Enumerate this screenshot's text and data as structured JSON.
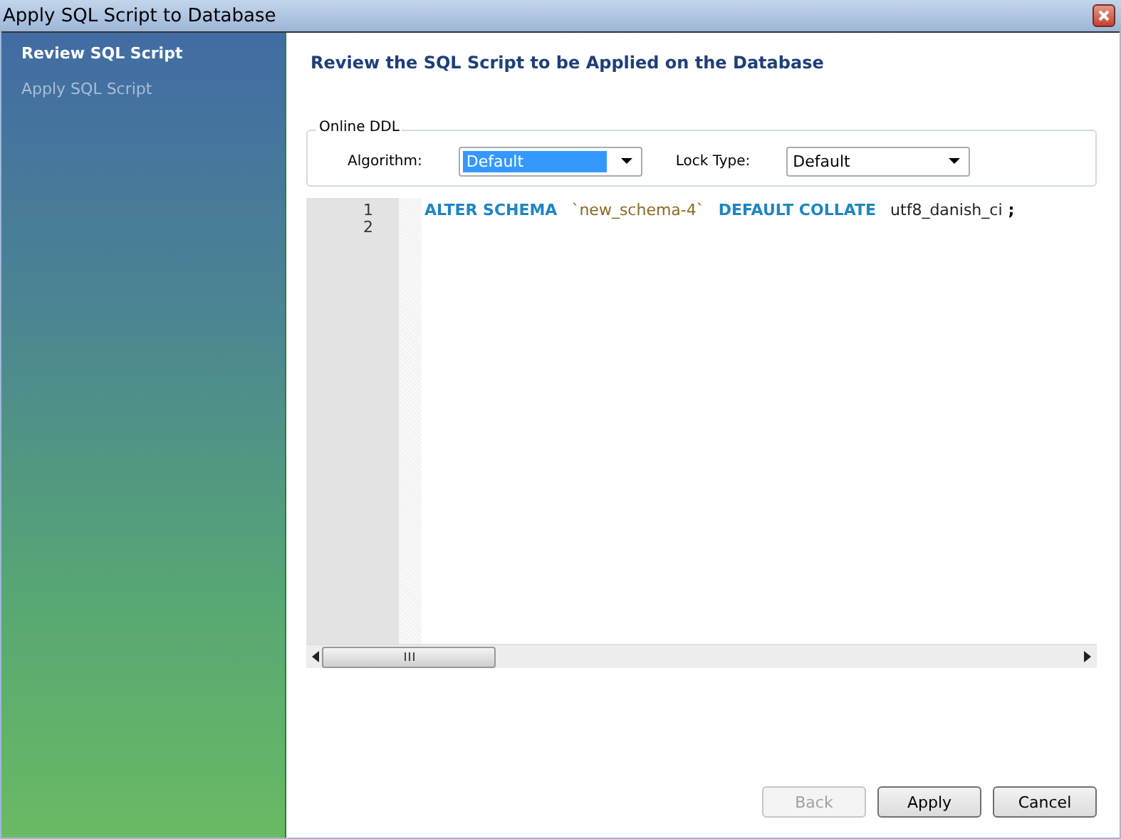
{
  "window": {
    "title": "Apply SQL Script to Database"
  },
  "sidebar": {
    "items": [
      {
        "label": "Review SQL Script",
        "selected": true
      },
      {
        "label": "Apply SQL Script",
        "selected": false
      }
    ]
  },
  "page_title": "Review the SQL Script to be Applied on the Database",
  "online_ddl": {
    "legend": "Online DDL",
    "algorithm": {
      "label": "Algorithm:",
      "value": "Default",
      "focused": true
    },
    "lock_type": {
      "label": "Lock Type:",
      "value": "Default",
      "focused": false
    }
  },
  "editor": {
    "lines": [
      {
        "number": "1",
        "tokens": [
          {
            "kind": "keyword",
            "text": "ALTER SCHEMA"
          },
          {
            "kind": "string",
            "text": "`new_schema-4`"
          },
          {
            "kind": "keyword",
            "text": "DEFAULT COLLATE"
          },
          {
            "kind": "plain",
            "text": "utf8_danish_ci"
          },
          {
            "kind": "punct",
            "text": ";"
          }
        ]
      },
      {
        "number": "2"
      }
    ]
  },
  "buttons": [
    {
      "label": "Back",
      "disabled": true
    },
    {
      "label": "Apply",
      "disabled": false
    },
    {
      "label": "Cancel",
      "disabled": false
    }
  ]
}
